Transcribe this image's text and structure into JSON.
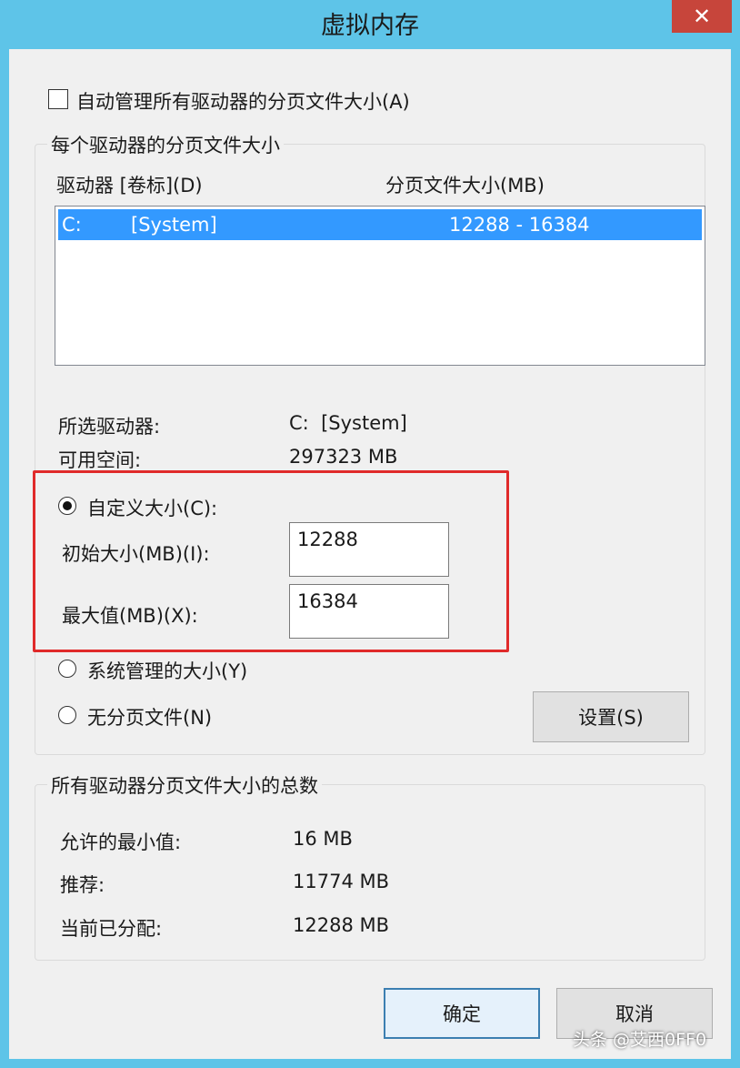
{
  "window": {
    "title": "虚拟内存",
    "close_glyph": "✕"
  },
  "auto_manage": {
    "label": "自动管理所有驱动器的分页文件大小(A)",
    "checked": false
  },
  "per_drive": {
    "group_title": "每个驱动器的分页文件大小",
    "col_drive": "驱动器 [卷标](D)",
    "col_size": "分页文件大小(MB)",
    "rows": [
      {
        "drive": "C:",
        "label": "[System]",
        "size": "12288 - 16384"
      }
    ],
    "selected_drive_label": "所选驱动器:",
    "selected_drive_value": "C:  [System]",
    "free_space_label": "可用空间:",
    "free_space_value": "297323 MB"
  },
  "options": {
    "custom_label": "自定义大小(C):",
    "initial_label": "初始大小(MB)(I):",
    "initial_value": "12288",
    "max_label": "最大值(MB)(X):",
    "max_value": "16384",
    "system_managed_label": "系统管理的大小(Y)",
    "no_paging_label": "无分页文件(N)",
    "selected": "custom",
    "set_button": "设置(S)"
  },
  "totals": {
    "group_title": "所有驱动器分页文件大小的总数",
    "min_label": "允许的最小值:",
    "min_value": "16 MB",
    "recommended_label": "推荐:",
    "recommended_value": "11774 MB",
    "allocated_label": "当前已分配:",
    "allocated_value": "12288 MB"
  },
  "buttons": {
    "ok": "确定",
    "cancel": "取消"
  },
  "watermark": "头条 @艾西0FF0",
  "colors": {
    "accent": "#3399ff",
    "highlight_border": "#e02a2a",
    "title_bar": "#5ec4e8",
    "close_button": "#c7453b"
  }
}
